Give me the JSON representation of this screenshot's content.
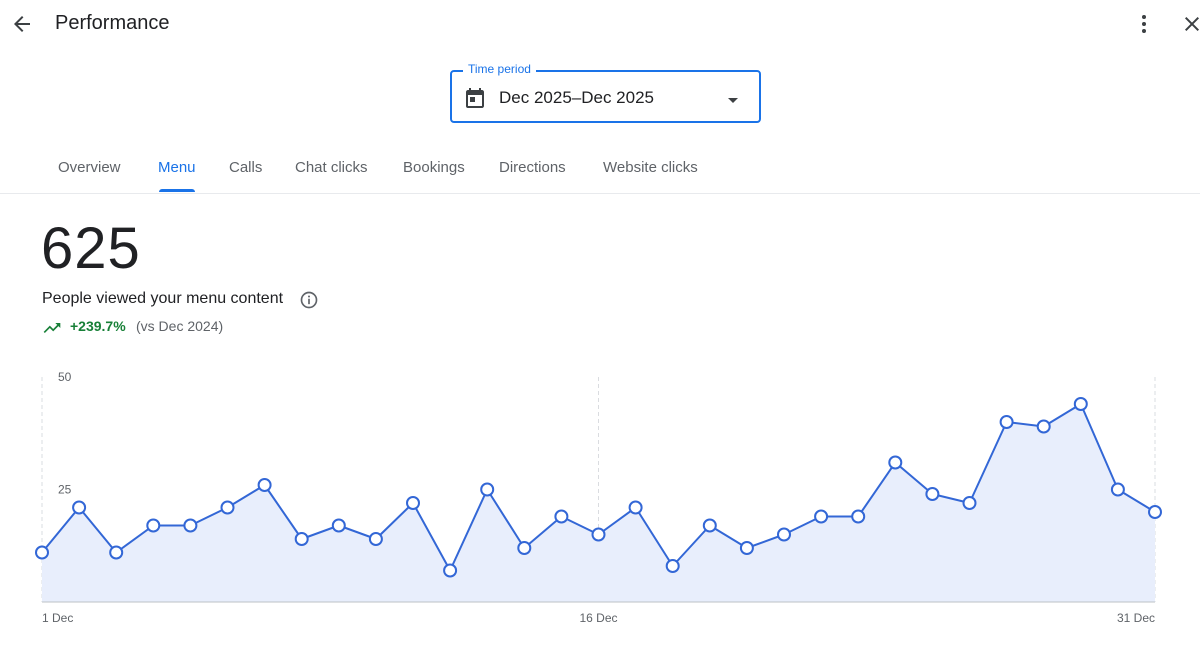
{
  "header": {
    "title": "Performance",
    "icons": {
      "back": "arrow-back-icon",
      "more": "more-vert-icon",
      "close": "close-icon"
    }
  },
  "time_period": {
    "label": "Time period",
    "value": "Dec 2025–Dec 2025",
    "icon": "calendar-icon",
    "caret": "arrow-drop-down-icon"
  },
  "tabs": [
    {
      "label": "Overview",
      "active": false
    },
    {
      "label": "Menu",
      "active": true
    },
    {
      "label": "Calls",
      "active": false
    },
    {
      "label": "Chat clicks",
      "active": false
    },
    {
      "label": "Bookings",
      "active": false
    },
    {
      "label": "Directions",
      "active": false
    },
    {
      "label": "Website clicks",
      "active": false
    }
  ],
  "metric": {
    "value": "625",
    "label": "People viewed your menu content",
    "trend": "+239.7%",
    "comparison": "(vs Dec 2024)"
  },
  "colors": {
    "accent": "#1a73e8",
    "line": "#3367d6",
    "area": "#e8eefc",
    "positive": "#188038",
    "muted": "#5f6368"
  },
  "chart_data": {
    "type": "area",
    "x": [
      1,
      2,
      3,
      4,
      5,
      6,
      7,
      8,
      9,
      10,
      11,
      12,
      13,
      14,
      15,
      16,
      17,
      18,
      19,
      20,
      21,
      22,
      23,
      24,
      25,
      26,
      27,
      28,
      29,
      30,
      31
    ],
    "series": [
      {
        "values": [
          11,
          21,
          11,
          17,
          17,
          21,
          26,
          14,
          17,
          14,
          22,
          7,
          25,
          12,
          19,
          15,
          21,
          8,
          17,
          12,
          15,
          19,
          19,
          31,
          24,
          22,
          40,
          39,
          44,
          25,
          20
        ]
      }
    ],
    "y_ticks": [
      "50",
      "25"
    ],
    "x_ticks": [
      {
        "x": 1,
        "label": "1 Dec"
      },
      {
        "x": 16,
        "label": "16 Dec"
      },
      {
        "x": 31,
        "label": "31 Dec"
      }
    ],
    "ylim": [
      0,
      50
    ],
    "xlim": [
      1,
      31
    ],
    "grid": "vertical-dashed"
  }
}
